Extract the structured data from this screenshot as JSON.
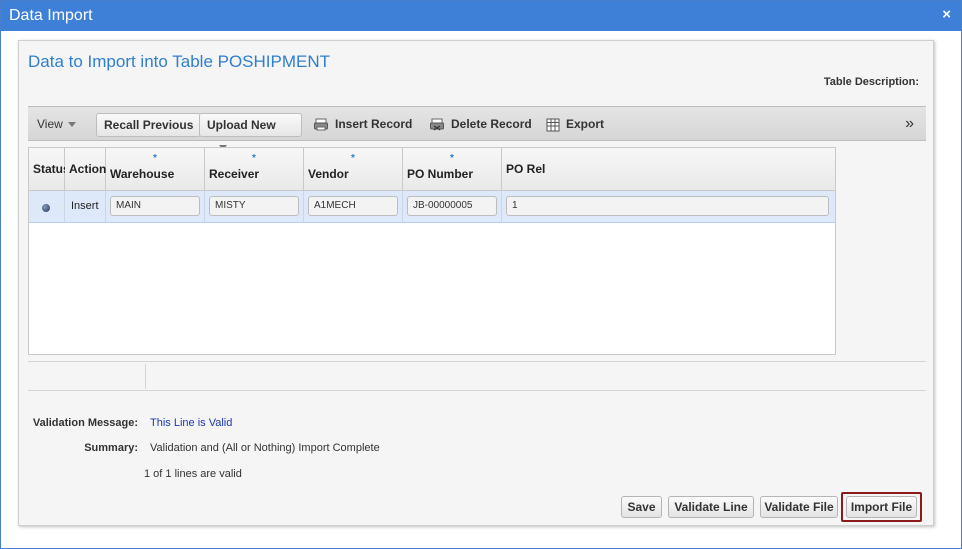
{
  "window": {
    "title": "Data Import",
    "close_symbol": "×"
  },
  "heading": "Data to Import into Table POSHIPMENT",
  "table_description_label": "Table Description:",
  "toolbar": {
    "view_label": "View",
    "recall_label": "Recall Previous",
    "upload_label": "Upload New",
    "insert_label": "Insert Record",
    "delete_label": "Delete Record",
    "export_label": "Export",
    "more_symbol": "»"
  },
  "grid": {
    "columns": [
      {
        "label": "Status",
        "required": false
      },
      {
        "label": "Action",
        "required": false
      },
      {
        "label": "Warehouse",
        "required": true
      },
      {
        "label": "Receiver",
        "required": true
      },
      {
        "label": "Vendor",
        "required": true
      },
      {
        "label": "PO Number",
        "required": true
      },
      {
        "label": "PO Rel",
        "required": false
      }
    ],
    "required_marker": "*",
    "rows": [
      {
        "status": "valid-dot",
        "action": "Insert",
        "warehouse": "MAIN",
        "receiver": "MISTY",
        "vendor": "A1MECH",
        "po_number": "JB-00000005",
        "po_rel": "1"
      }
    ]
  },
  "validation": {
    "message_label": "Validation Message:",
    "message_value": "This Line is Valid",
    "summary_label": "Summary:",
    "summary_value": "Validation and (All or Nothing) Import Complete",
    "count_text": "1 of 1 lines are valid"
  },
  "buttons": {
    "save": "Save",
    "validate_line": "Validate Line",
    "validate_file": "Validate File",
    "import_file": "Import File"
  },
  "colors": {
    "titlebar": "#3e7fd8",
    "heading": "#2f7fd0",
    "valid_message": "#1a37b0",
    "import_highlight": "#8b1a1a",
    "row_selected": "#dde9f9"
  }
}
